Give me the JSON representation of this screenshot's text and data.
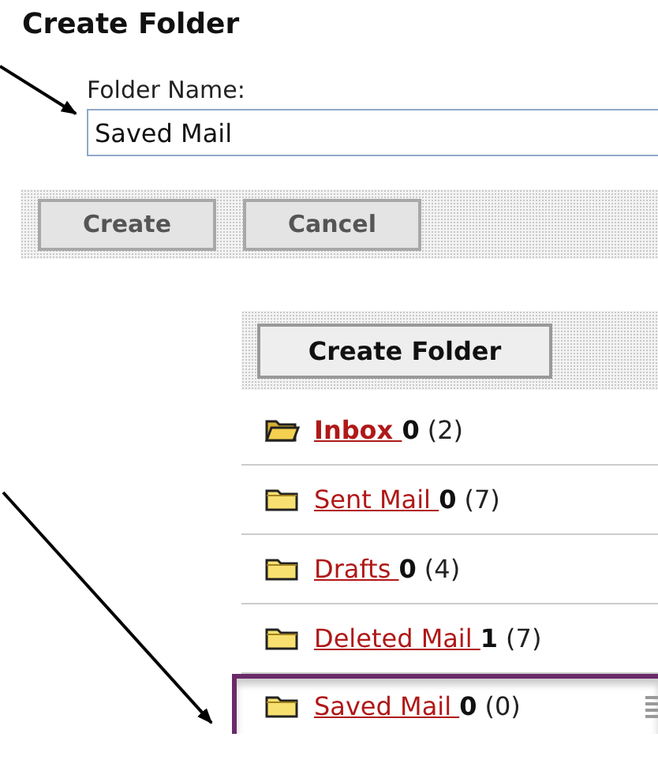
{
  "form": {
    "title": "Create Folder",
    "field_label": "Folder Name:",
    "field_value": "Saved Mail",
    "buttons": [
      "Create",
      "Cancel"
    ]
  },
  "folder_pane": {
    "button": "Create Folder",
    "folders": [
      {
        "name": "Inbox ",
        "unread": "0",
        "total": "(2)",
        "current": true,
        "highlighted": false
      },
      {
        "name": "Sent Mail ",
        "unread": "0",
        "total": "(7)",
        "current": false,
        "highlighted": false
      },
      {
        "name": "Drafts ",
        "unread": "0",
        "total": "(4)",
        "current": false,
        "highlighted": false
      },
      {
        "name": "Deleted Mail ",
        "unread": "1",
        "total": "(7)",
        "current": false,
        "highlighted": false
      },
      {
        "name": "Saved Mail ",
        "unread": "0",
        "total": "(0)",
        "current": false,
        "highlighted": true
      }
    ]
  }
}
